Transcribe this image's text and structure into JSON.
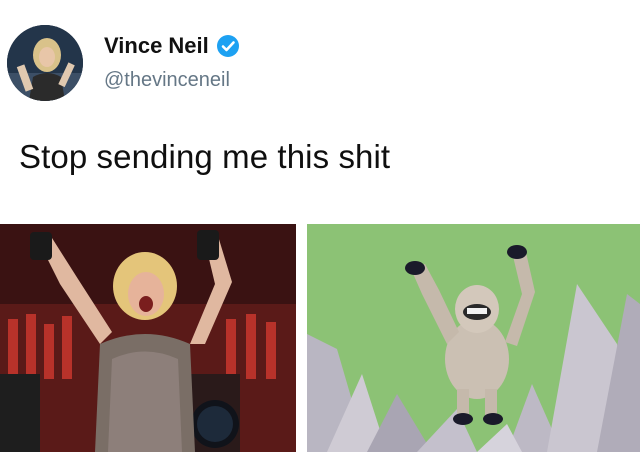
{
  "tweet": {
    "author": {
      "name": "Vince Neil",
      "handle": "@thevinceneil",
      "verified": true,
      "avatar_icon": "profile-photo"
    },
    "text": "Stop sending me this shit",
    "media": [
      {
        "icon": "concert-photo"
      },
      {
        "icon": "yeti-photo"
      }
    ]
  },
  "colors": {
    "verified": "#1da1f2",
    "handle": "#657786",
    "text": "#0f0f0f",
    "stage_red": "#9c2a24",
    "sky_green": "#8cc275"
  }
}
